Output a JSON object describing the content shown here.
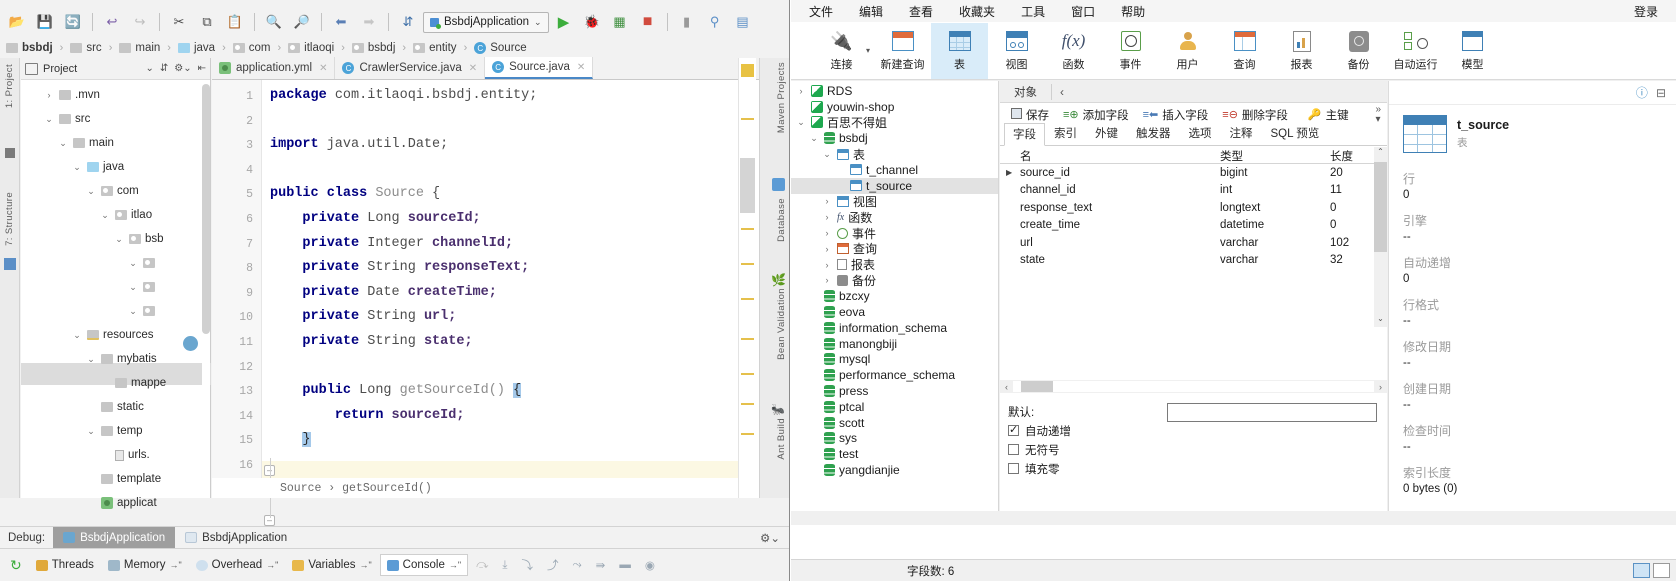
{
  "ide": {
    "toolbar": {
      "icons": [
        "open-folder-icon",
        "save-all-icon",
        "sync-icon",
        "undo-icon",
        "redo-icon",
        "cut-icon",
        "copy-icon",
        "paste-icon",
        "find-icon",
        "find-replace-icon",
        "back-icon",
        "forward-icon",
        "sort-icon"
      ],
      "run_config": "BsbdjApplication",
      "run_icons": [
        "run-icon",
        "debug-icon",
        "run-coverage-icon",
        "stop-icon",
        "profiler-icon",
        "search-everywhere-icon",
        "layout-icon"
      ]
    },
    "breadcrumb": [
      "bsbdj",
      "src",
      "main",
      "java",
      "com",
      "itlaoqi",
      "bsbdj",
      "entity",
      "Source"
    ],
    "left_rail": [
      "1: Project",
      "7: Structure"
    ],
    "right_rail": [
      "Maven Projects",
      "Database",
      "Bean Validation",
      "Ant Build"
    ],
    "project": {
      "title": "Project",
      "tree": [
        {
          "indent": 1,
          "arrow": "›",
          "label": ".mvn",
          "icon": "folder-icon"
        },
        {
          "indent": 1,
          "arrow": "⌄",
          "label": "src",
          "icon": "folder-icon"
        },
        {
          "indent": 2,
          "arrow": "⌄",
          "label": "main",
          "icon": "folder-icon"
        },
        {
          "indent": 3,
          "arrow": "⌄",
          "label": "java",
          "icon": "source-folder-icon"
        },
        {
          "indent": 4,
          "arrow": "⌄",
          "label": "com",
          "icon": "package-icon"
        },
        {
          "indent": 5,
          "arrow": "⌄",
          "label": "itlao",
          "icon": "package-icon"
        },
        {
          "indent": 6,
          "arrow": "⌄",
          "label": "bsb",
          "icon": "package-icon"
        },
        {
          "indent": 7,
          "arrow": "⌄",
          "label": "",
          "icon": "package-icon"
        },
        {
          "indent": 7,
          "arrow": "⌄",
          "label": "",
          "icon": "package-icon"
        },
        {
          "indent": 7,
          "arrow": "⌄",
          "label": "",
          "icon": "package-icon"
        },
        {
          "indent": 3,
          "arrow": "⌄",
          "label": "resources",
          "icon": "resource-folder-icon"
        },
        {
          "indent": 4,
          "arrow": "⌄",
          "label": "mybatis",
          "icon": "folder-icon"
        },
        {
          "indent": 5,
          "arrow": "",
          "label": "mappe",
          "icon": "folder-icon"
        },
        {
          "indent": 4,
          "arrow": "",
          "label": "static",
          "icon": "folder-icon"
        },
        {
          "indent": 4,
          "arrow": "⌄",
          "label": "temp",
          "icon": "folder-icon"
        },
        {
          "indent": 5,
          "arrow": "",
          "label": "urls.",
          "icon": "file-icon"
        },
        {
          "indent": 4,
          "arrow": "",
          "label": "template",
          "icon": "folder-icon"
        },
        {
          "indent": 4,
          "arrow": "",
          "label": "applicat",
          "icon": "yml-icon"
        }
      ]
    },
    "editor": {
      "tabs": [
        {
          "label": "application.yml",
          "icon": "yml-icon",
          "active": false
        },
        {
          "label": "CrawlerService.java",
          "icon": "class-icon",
          "active": false
        },
        {
          "label": "Source.java",
          "icon": "class-icon",
          "active": true
        }
      ],
      "line_numbers": [
        "1",
        "2",
        "3",
        "4",
        "5",
        "6",
        "7",
        "8",
        "9",
        "10",
        "11",
        "12",
        "13",
        "14",
        "15",
        "16"
      ],
      "code": [
        {
          "line": 1,
          "segments": [
            {
              "t": "package",
              "c": "kw"
            },
            {
              "t": " com.itlaoqi.bsbdj.entity;",
              "c": "typ"
            }
          ]
        },
        {
          "line": 3,
          "segments": [
            {
              "t": "import",
              "c": "kw"
            },
            {
              "t": " java.util.Date;",
              "c": "typ"
            }
          ]
        },
        {
          "line": 5,
          "segments": [
            {
              "t": "public class",
              "c": "kw"
            },
            {
              "t": " Source ",
              "c": "mth"
            },
            {
              "t": "{",
              "c": "typ"
            }
          ]
        },
        {
          "line": 6,
          "segments": [
            {
              "t": "    private",
              "c": "kw"
            },
            {
              "t": " Long ",
              "c": "typ"
            },
            {
              "t": "sourceId;",
              "c": "fld"
            }
          ]
        },
        {
          "line": 7,
          "segments": [
            {
              "t": "    private",
              "c": "kw"
            },
            {
              "t": " Integer ",
              "c": "typ"
            },
            {
              "t": "channelId;",
              "c": "fld"
            }
          ]
        },
        {
          "line": 8,
          "segments": [
            {
              "t": "    private",
              "c": "kw"
            },
            {
              "t": " String ",
              "c": "typ"
            },
            {
              "t": "responseText;",
              "c": "fld"
            }
          ]
        },
        {
          "line": 9,
          "segments": [
            {
              "t": "    private",
              "c": "kw"
            },
            {
              "t": " Date ",
              "c": "typ"
            },
            {
              "t": "createTime;",
              "c": "fld"
            }
          ]
        },
        {
          "line": 10,
          "segments": [
            {
              "t": "    private",
              "c": "kw"
            },
            {
              "t": " String ",
              "c": "typ"
            },
            {
              "t": "url;",
              "c": "fld"
            }
          ]
        },
        {
          "line": 11,
          "segments": [
            {
              "t": "    private",
              "c": "kw"
            },
            {
              "t": " String ",
              "c": "typ"
            },
            {
              "t": "state;",
              "c": "fld"
            }
          ]
        },
        {
          "line": 13,
          "segments": [
            {
              "t": "    public",
              "c": "kw"
            },
            {
              "t": " Long ",
              "c": "typ"
            },
            {
              "t": "getSourceId()",
              "c": "mth"
            },
            {
              "t": " ",
              "c": "typ"
            },
            {
              "t": "{",
              "c": "brace"
            }
          ]
        },
        {
          "line": 14,
          "segments": [
            {
              "t": "        return",
              "c": "kw"
            },
            {
              "t": " ",
              "c": "typ"
            },
            {
              "t": "sourceId;",
              "c": "fld"
            }
          ]
        },
        {
          "line": 15,
          "segments": [
            {
              "t": "    ",
              "c": "typ"
            },
            {
              "t": "}",
              "c": "brace"
            }
          ]
        }
      ],
      "status_breadcrumb": "Source › getSourceId()"
    },
    "debug": {
      "label": "Debug:",
      "tabs": [
        "BsbdjApplication",
        "BsbdjApplication"
      ],
      "tools": [
        "Threads",
        "Memory",
        "Overhead",
        "Variables",
        "Console"
      ],
      "gear": "settings-icon"
    }
  },
  "navicat": {
    "menubar": [
      "文件",
      "编辑",
      "查看",
      "收藏夹",
      "工具",
      "窗口",
      "帮助"
    ],
    "login": "登录",
    "ribbon": [
      {
        "label": "连接",
        "icon": "connection-icon",
        "active": false,
        "caret": true
      },
      {
        "label": "新建查询",
        "icon": "new-query-icon",
        "active": false
      },
      {
        "label": "表",
        "icon": "table-icon",
        "active": true
      },
      {
        "label": "视图",
        "icon": "view-icon",
        "active": false
      },
      {
        "label": "函数",
        "icon": "function-icon",
        "active": false
      },
      {
        "label": "事件",
        "icon": "event-icon",
        "active": false
      },
      {
        "label": "用户",
        "icon": "user-icon",
        "active": false
      },
      {
        "label": "查询",
        "icon": "query-icon",
        "active": false
      },
      {
        "label": "报表",
        "icon": "report-icon",
        "active": false
      },
      {
        "label": "备份",
        "icon": "backup-icon",
        "active": false
      },
      {
        "label": "自动运行",
        "icon": "automation-icon",
        "active": false
      },
      {
        "label": "模型",
        "icon": "model-icon",
        "active": false
      }
    ],
    "tree": [
      {
        "indent": 0,
        "arrow": "›",
        "label": "RDS",
        "icon": "connection-icon"
      },
      {
        "indent": 0,
        "arrow": "",
        "label": "youwin-shop",
        "icon": "connection-icon"
      },
      {
        "indent": 0,
        "arrow": "⌄",
        "label": "百思不得姐",
        "icon": "connection-icon"
      },
      {
        "indent": 1,
        "arrow": "⌄",
        "label": "bsbdj",
        "icon": "database-icon"
      },
      {
        "indent": 2,
        "arrow": "⌄",
        "label": "表",
        "icon": "table-icon"
      },
      {
        "indent": 3,
        "arrow": "",
        "label": "t_channel",
        "icon": "table-icon"
      },
      {
        "indent": 3,
        "arrow": "",
        "label": "t_source",
        "icon": "table-icon",
        "selected": true
      },
      {
        "indent": 2,
        "arrow": "›",
        "label": "视图",
        "icon": "view-icon"
      },
      {
        "indent": 2,
        "arrow": "›",
        "label": "函数",
        "icon": "function-icon"
      },
      {
        "indent": 2,
        "arrow": "›",
        "label": "事件",
        "icon": "event-icon"
      },
      {
        "indent": 2,
        "arrow": "›",
        "label": "查询",
        "icon": "query-icon"
      },
      {
        "indent": 2,
        "arrow": "›",
        "label": "报表",
        "icon": "report-icon"
      },
      {
        "indent": 2,
        "arrow": "›",
        "label": "备份",
        "icon": "backup-icon"
      },
      {
        "indent": 1,
        "arrow": "",
        "label": "bzcxy",
        "icon": "database-icon"
      },
      {
        "indent": 1,
        "arrow": "",
        "label": "eova",
        "icon": "database-icon"
      },
      {
        "indent": 1,
        "arrow": "",
        "label": "information_schema",
        "icon": "database-icon"
      },
      {
        "indent": 1,
        "arrow": "",
        "label": "manongbiji",
        "icon": "database-icon"
      },
      {
        "indent": 1,
        "arrow": "",
        "label": "mysql",
        "icon": "database-icon"
      },
      {
        "indent": 1,
        "arrow": "",
        "label": "performance_schema",
        "icon": "database-icon"
      },
      {
        "indent": 1,
        "arrow": "",
        "label": "press",
        "icon": "database-icon"
      },
      {
        "indent": 1,
        "arrow": "",
        "label": "ptcal",
        "icon": "database-icon"
      },
      {
        "indent": 1,
        "arrow": "",
        "label": "scott",
        "icon": "database-icon"
      },
      {
        "indent": 1,
        "arrow": "",
        "label": "sys",
        "icon": "database-icon"
      },
      {
        "indent": 1,
        "arrow": "",
        "label": "test",
        "icon": "database-icon"
      },
      {
        "indent": 1,
        "arrow": "",
        "label": "yangdianjie",
        "icon": "database-icon"
      }
    ],
    "object_bar": {
      "label": "对象",
      "chevron": "‹"
    },
    "designer_actions": [
      {
        "label": "保存",
        "icon": "save-icon"
      },
      {
        "label": "添加字段",
        "icon": "add-field-icon"
      },
      {
        "label": "插入字段",
        "icon": "insert-field-icon"
      },
      {
        "label": "删除字段",
        "icon": "delete-field-icon"
      },
      {
        "label": "主键",
        "icon": "primary-key-icon"
      }
    ],
    "designer_tabs": [
      "字段",
      "索引",
      "外键",
      "触发器",
      "选项",
      "注释",
      "SQL 预览"
    ],
    "grid": {
      "headers": [
        "名",
        "类型",
        "长度"
      ],
      "rows": [
        {
          "name": "source_id",
          "type": "bigint",
          "length": "20",
          "current": true
        },
        {
          "name": "channel_id",
          "type": "int",
          "length": "11",
          "current": false
        },
        {
          "name": "response_text",
          "type": "longtext",
          "length": "0",
          "current": false
        },
        {
          "name": "create_time",
          "type": "datetime",
          "length": "0",
          "current": false
        },
        {
          "name": "url",
          "type": "varchar",
          "length": "102",
          "current": false
        },
        {
          "name": "state",
          "type": "varchar",
          "length": "32",
          "current": false
        }
      ]
    },
    "props": {
      "default_label": "默认:",
      "default_value": "",
      "checkboxes": [
        {
          "label": "自动递增",
          "checked": true
        },
        {
          "label": "无符号",
          "checked": false
        },
        {
          "label": "填充零",
          "checked": false
        }
      ]
    },
    "info": {
      "title": "t_source",
      "subtitle": "表",
      "icon": "table-large-icon",
      "items": [
        {
          "key": "行",
          "value": "0"
        },
        {
          "key": "引擎",
          "value": "--"
        },
        {
          "key": "自动递增",
          "value": "0"
        },
        {
          "key": "行格式",
          "value": "--"
        },
        {
          "key": "修改日期",
          "value": "--"
        },
        {
          "key": "创建日期",
          "value": "--"
        },
        {
          "key": "检查时间",
          "value": "--"
        },
        {
          "key": "索引长度",
          "value": "0 bytes (0)"
        }
      ]
    },
    "status": {
      "count_label": "字段数: 6"
    }
  }
}
